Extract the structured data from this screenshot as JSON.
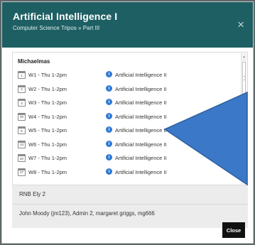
{
  "dialog": {
    "title": "Artificial Intelligence I",
    "breadcrumb": "Computer Science Tripos  »  Part III",
    "close_icon": "×"
  },
  "term": "Michaelmas",
  "sessions": [
    {
      "day": "1",
      "when": "W1 - Thu 1-2pm",
      "course": "Artificial Intelligence II"
    },
    {
      "day": "2",
      "when": "W2 - Thu 1-2pm",
      "course": "Artificial Intelligence II"
    },
    {
      "day": "3",
      "when": "W3 - Thu 1-2pm",
      "course": "Artificial Intelligence II"
    },
    {
      "day": "30",
      "when": "W4 - Thu 1-2pm",
      "course": "Artificial Intelligence II"
    },
    {
      "day": "5",
      "when": "W5 - Thu 1-2pm",
      "course": "Artificial Intelligence II"
    },
    {
      "day": "13",
      "when": "W6 - Thu 1-2pm",
      "course": "Artificial Intelligence II"
    },
    {
      "day": "20",
      "when": "W7 - Thu 1-2pm",
      "course": "Artificial Intelligence II"
    },
    {
      "day": "27",
      "when": "W8 - Thu 1-2pm",
      "course": "Artificial Intelligence II"
    }
  ],
  "details": {
    "room": "RNB Ely 2",
    "people": "John Moody (jm123), Admin 2, margaret griggs, mg666"
  },
  "footer": {
    "close_label": "Close"
  },
  "colors": {
    "header": "#1d5f63",
    "info": "#2f7ad3",
    "arrow": "#3b78c7"
  },
  "icons": {
    "calendar": "calendar-icon",
    "info": "info-icon",
    "close": "close-icon"
  }
}
